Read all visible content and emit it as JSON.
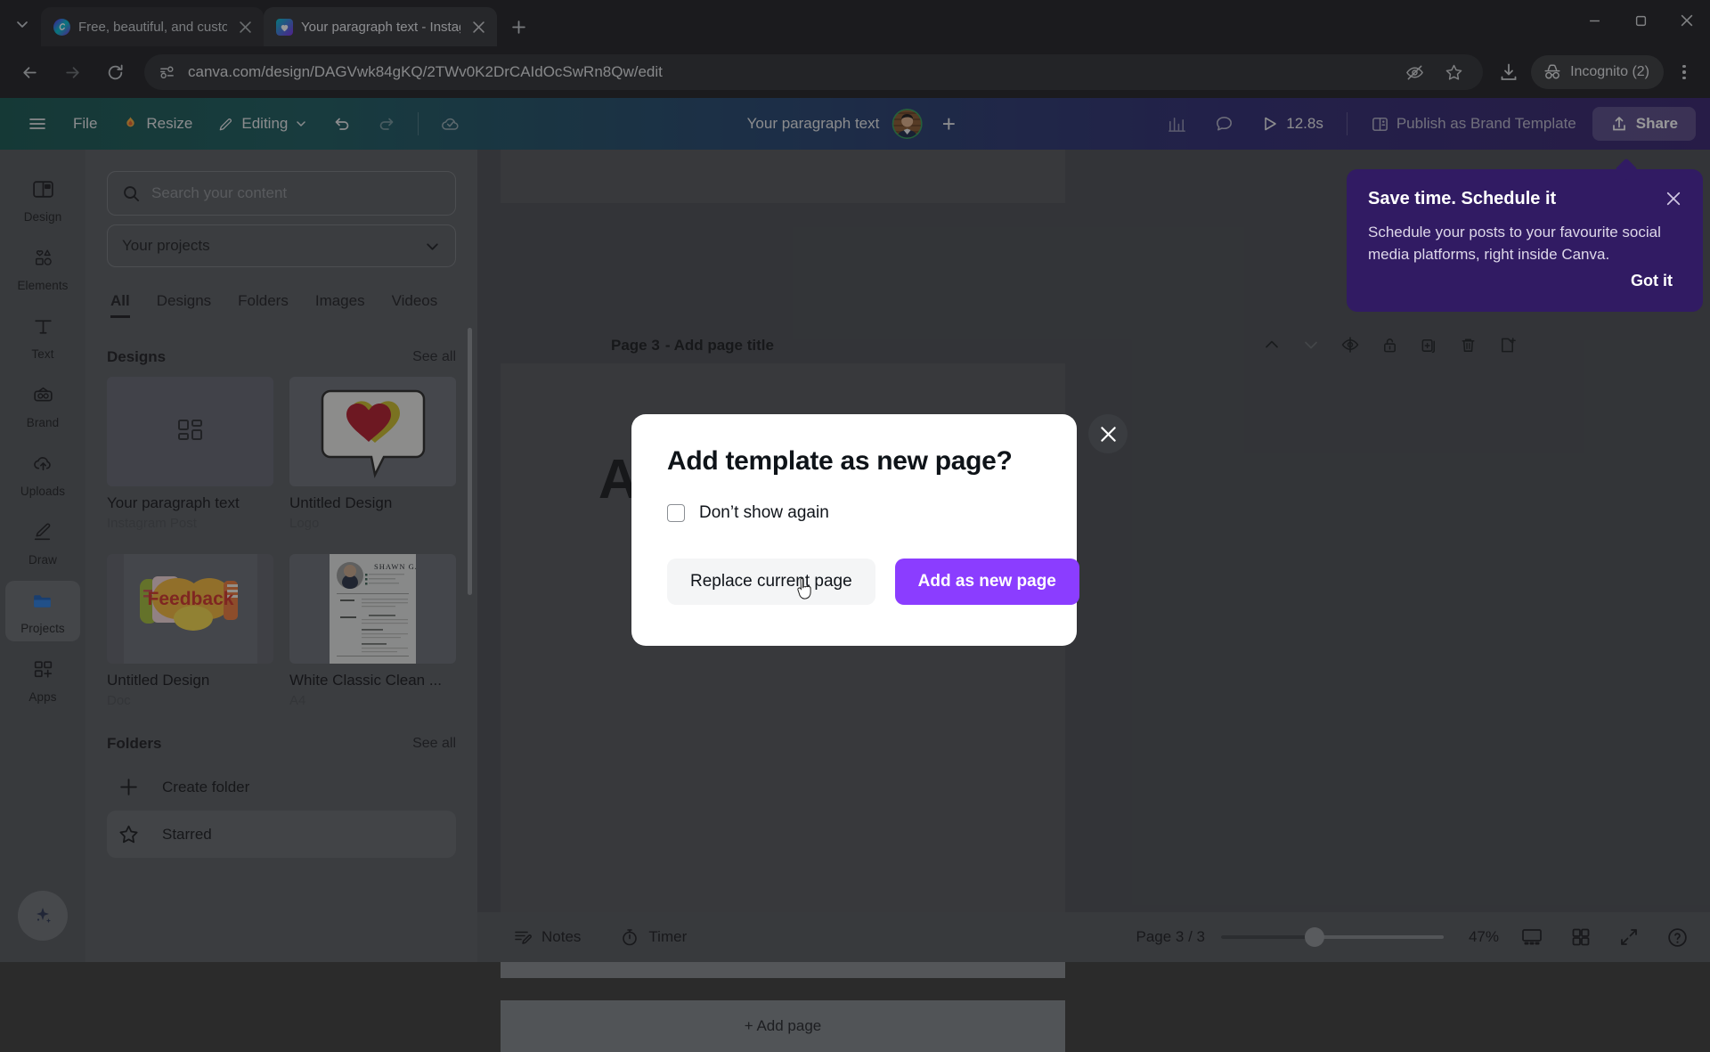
{
  "browser": {
    "tabs": [
      {
        "title": "Free, beautiful, and customizab",
        "favicon": "canva-logo-icon",
        "active": false
      },
      {
        "title": "Your paragraph text - Instagram",
        "favicon": "canva-heart-icon",
        "active": true
      }
    ],
    "url": "canva.com/design/DAGVwk84gKQ/2TWv0K2DrCAIdOcSwRn8Qw/edit",
    "incognito_label": "Incognito (2)",
    "icons": {
      "tab_list": "chevron-down-icon",
      "new_tab": "plus-icon",
      "back": "back-arrow-icon",
      "forward": "forward-arrow-icon",
      "reload": "reload-icon",
      "site_info": "page-info-icon",
      "tracking": "eye-off-icon",
      "bookmark": "star-icon",
      "download": "download-icon",
      "incognito": "incognito-icon",
      "menu": "three-dots-icon",
      "minimize": "minimize-icon",
      "maximize": "maximize-icon",
      "close": "close-icon"
    }
  },
  "topbar": {
    "menu_label": "hamburger-menu",
    "file_label": "File",
    "resize_label": "Resize",
    "editing_label": "Editing",
    "doc_title": "Your paragraph text",
    "timer_label": "12.8s",
    "publish_label": "Publish as Brand Template",
    "share_label": "Share"
  },
  "rail": {
    "items": [
      {
        "label": "Design",
        "icon": "design-icon",
        "active": false
      },
      {
        "label": "Elements",
        "icon": "elements-icon",
        "active": false
      },
      {
        "label": "Text",
        "icon": "text-icon",
        "active": false
      },
      {
        "label": "Brand",
        "icon": "brand-icon",
        "active": false
      },
      {
        "label": "Uploads",
        "icon": "uploads-icon",
        "active": false
      },
      {
        "label": "Draw",
        "icon": "draw-icon",
        "active": false
      },
      {
        "label": "Projects",
        "icon": "projects-icon",
        "active": true
      },
      {
        "label": "Apps",
        "icon": "apps-icon",
        "active": false
      }
    ],
    "magic_button": "magic-studio-icon"
  },
  "panel": {
    "search_placeholder": "Search your content",
    "project_select": "Your projects",
    "tabs": [
      {
        "label": "All",
        "active": true
      },
      {
        "label": "Designs",
        "active": false
      },
      {
        "label": "Folders",
        "active": false
      },
      {
        "label": "Images",
        "active": false
      },
      {
        "label": "Videos",
        "active": false
      }
    ],
    "designs_section": {
      "title": "Designs",
      "see_all": "See all"
    },
    "designs": [
      {
        "name": "Your paragraph text",
        "type": "Instagram Post",
        "thumb": "grid-placeholder"
      },
      {
        "name": "Untitled Design",
        "type": "Logo",
        "thumb": "heart-speech-bubble"
      },
      {
        "name": "Untitled Design",
        "type": "Doc",
        "thumb": "feedback-graphic"
      },
      {
        "name": "White Classic Clean ...",
        "type": "A4",
        "thumb": "resume-shawn-garcia"
      }
    ],
    "folders_section": {
      "title": "Folders",
      "see_all": "See all"
    },
    "folders": [
      {
        "label": "Create folder",
        "icon": "plus-icon"
      },
      {
        "label": "Starred",
        "icon": "star-icon"
      }
    ]
  },
  "canvas": {
    "page_label": "Page 3",
    "page_title_placeholder": "- Add page title",
    "heading_text": "Add a heading",
    "add_page_label": "+ Add page",
    "tools": [
      "move-up-icon",
      "move-down-icon",
      "hide-page-icon",
      "lock-page-icon",
      "duplicate-page-icon",
      "delete-page-icon",
      "add-page-icon"
    ]
  },
  "bottombar": {
    "notes_label": "Notes",
    "timer_label": "Timer",
    "page_count": "Page 3 / 3",
    "zoom_level": "47%",
    "icons": [
      "present-view-icon",
      "grid-view-icon",
      "fullscreen-icon",
      "help-icon"
    ]
  },
  "modal": {
    "title": "Add template as new page?",
    "checkbox_label": "Don’t show again",
    "secondary_button": "Replace current page",
    "primary_button": "Add as new page",
    "close_icon": "close-icon",
    "primary_color": "#8b3dff"
  },
  "toast": {
    "title": "Save time. Schedule it",
    "body": "Schedule your posts to your favourite social media platforms, right inside Canva.",
    "action": "Got it",
    "close_icon": "close-icon",
    "background": "#311b63"
  }
}
